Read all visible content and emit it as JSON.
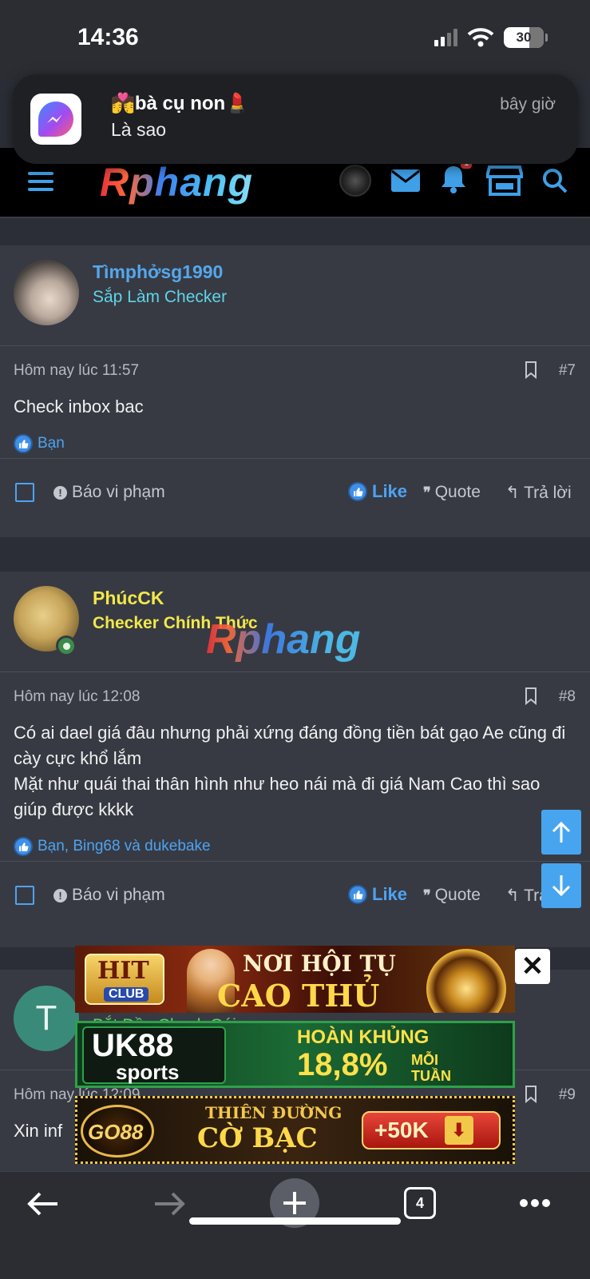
{
  "status_bar": {
    "time": "14:36",
    "battery": "30"
  },
  "notification": {
    "title": "💏bà cụ non💄",
    "body": "Là sao",
    "time": "bây giờ",
    "app_icon": "messenger-icon"
  },
  "header": {
    "logo": "Rphang",
    "notification_count": "1",
    "icons": [
      "menu-icon",
      "avatar",
      "mail-icon",
      "bell-icon",
      "store-icon",
      "search-icon"
    ]
  },
  "watermark": "Rphang",
  "posts": [
    {
      "username": "Tìmphởsg1990",
      "rank": "Sắp Làm Checker",
      "date": "Hôm nay lúc 11:57",
      "number": "#7",
      "body": [
        "Check inbox bac"
      ],
      "reactions": "Bạn",
      "actions": {
        "report": "Báo vi phạm",
        "like": "Like",
        "quote": "Quote",
        "reply": "Trả lời"
      }
    },
    {
      "username": "PhúcCK",
      "rank": "Checker Chính Thức",
      "date": "Hôm nay lúc 12:08",
      "number": "#8",
      "body": [
        "Có ai dael giá đâu nhưng phải xứng đáng đồng tiền bát gạo Ae cũng đi cày cực khổ lắm",
        "Mặt như quái thai thân hình như heo nái mà đi giá Nam Cao thì sao giúp được kkkk"
      ],
      "reactions": "Bạn, Bing68 và dukebake",
      "actions": {
        "report": "Báo vi phạm",
        "like": "Like",
        "quote": "Quote",
        "reply": "Trả lời"
      }
    },
    {
      "avatar_letter": "T",
      "rank": "Bắt Đầu Check Gái",
      "date": "Hôm nay lúc 12:09",
      "number": "#9",
      "body": [
        "Xin inf"
      ]
    }
  ],
  "ads": [
    {
      "brand_top": "HIT",
      "brand_bottom": "CLUB",
      "line1": "NƠI HỘI TỤ",
      "line2": "CAO THỦ"
    },
    {
      "brand_top": "UK88",
      "brand_bottom": "sports",
      "line1": "HOÀN KHỦNG",
      "line2": "18,8%",
      "line3": "MỖI",
      "line4": "TUẦN"
    },
    {
      "brand_top": "GO88",
      "line1": "THIÊN ĐƯỜNG",
      "line2": "CỜ BẠC",
      "cta": "+50K"
    }
  ],
  "ad_close": "✕",
  "toolbar": {
    "tab_count": "4"
  },
  "colors": {
    "accent": "#4ea3f0",
    "rank_teal": "#5fd4e8",
    "rank_yellow": "#f2e84a",
    "rank_green": "#5fcf6a",
    "username_blue": "#55a7ec",
    "username_yellow": "#f2e84a"
  }
}
